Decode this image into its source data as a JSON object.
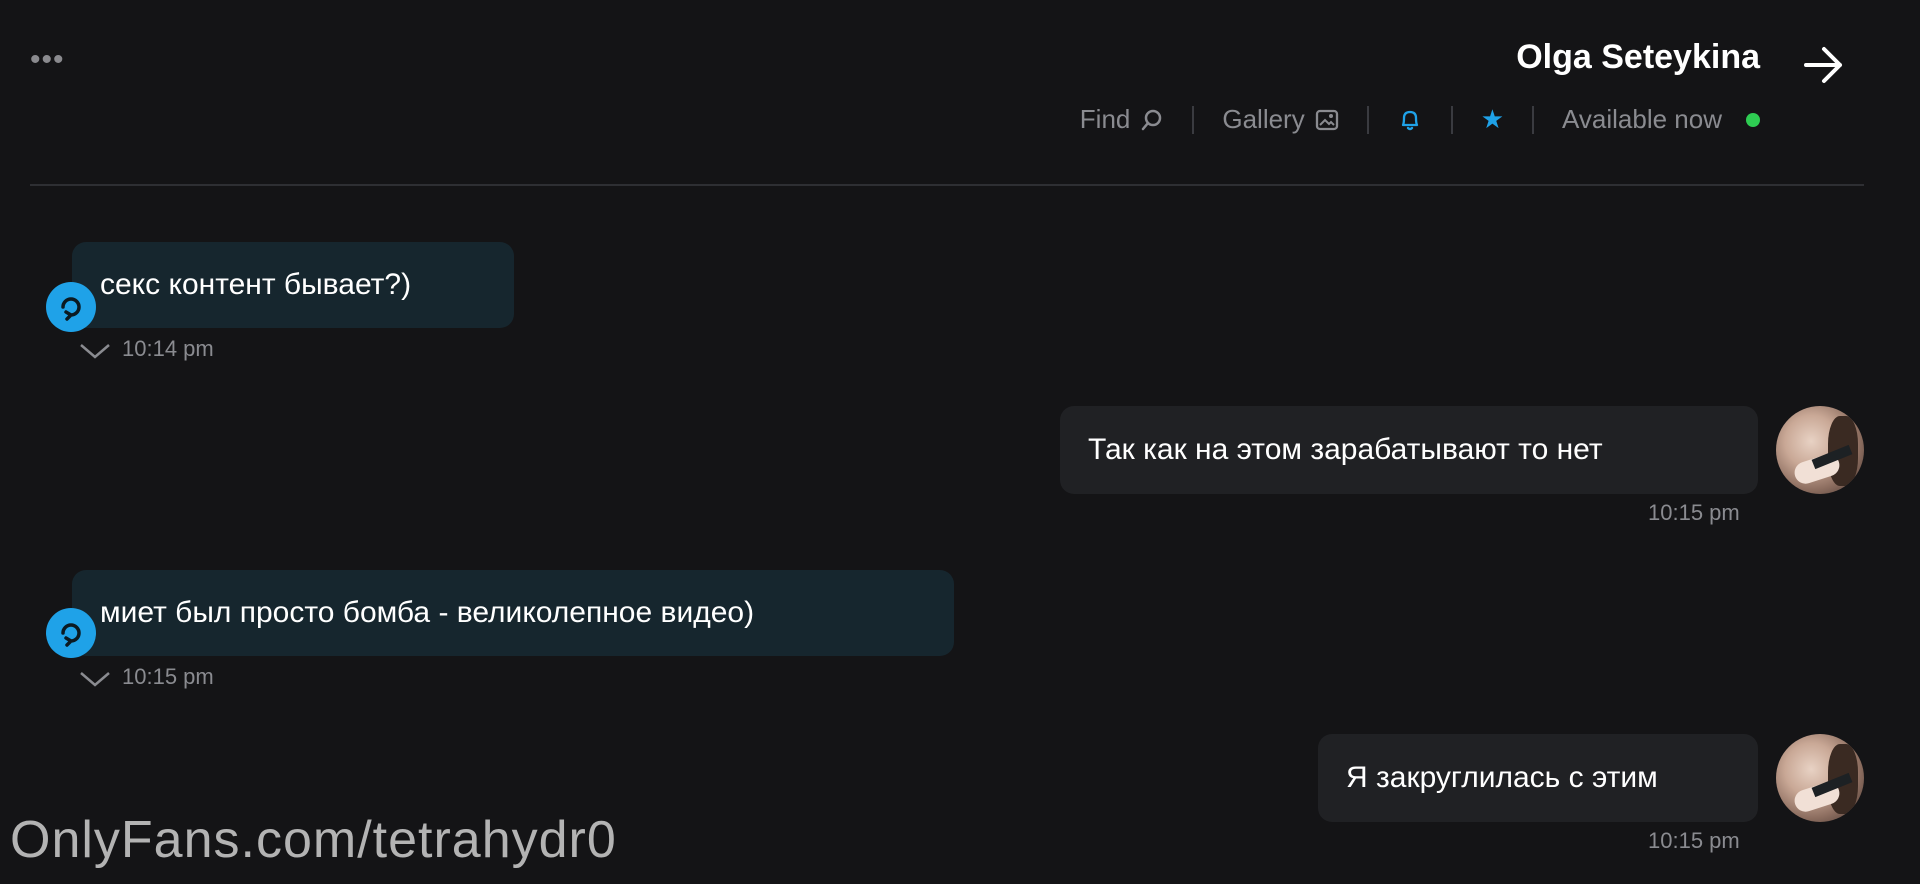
{
  "header": {
    "contact_name": "Olga Seteykina",
    "status_text": "Available now",
    "gallery_label": "Gallery",
    "find_label": "Find",
    "more_label": "•••"
  },
  "colors": {
    "online": "#2ecc52",
    "accent": "#1fa2e8",
    "incoming_bubble": "#16262e",
    "outgoing_bubble": "#202124"
  },
  "messages": [
    {
      "direction": "incoming",
      "text": "секс контент бывает?)",
      "time": "10:14 pm"
    },
    {
      "direction": "outgoing",
      "text": "Так как на этом зарабатывают то нет",
      "time": "10:15 pm"
    },
    {
      "direction": "incoming",
      "text": "миет был просто бомба - великолепное видео)",
      "time": "10:15 pm"
    },
    {
      "direction": "outgoing",
      "text": "Я закруглилась с этим",
      "time": "10:15 pm"
    }
  ],
  "watermark": "OnlyFans.com/tetrahydr0"
}
